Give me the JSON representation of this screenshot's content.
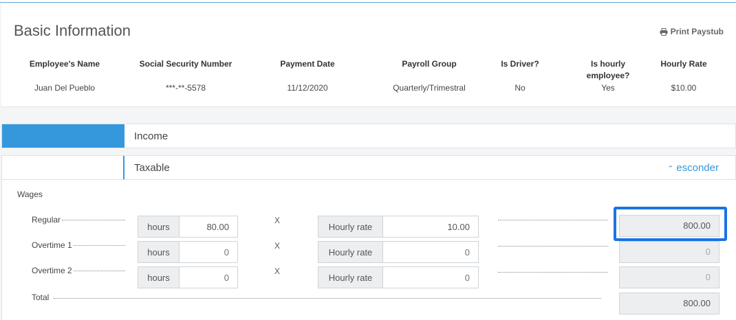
{
  "basic_info": {
    "title": "Basic Information",
    "print_label": "Print Paystub",
    "columns": [
      {
        "header": "Employee's Name",
        "value": "Juan Del Pueblo"
      },
      {
        "header": "Social Security Number",
        "value": "***-**-5578"
      },
      {
        "header": "Payment Date",
        "value": "11/12/2020"
      },
      {
        "header": "Payroll Group",
        "value": "Quarterly/Trimestral"
      },
      {
        "header": "Is Driver?",
        "value": "No"
      },
      {
        "header": "Is hourly employee?",
        "value": "Yes"
      },
      {
        "header": "Hourly Rate",
        "value": "$10.00"
      }
    ]
  },
  "sections": {
    "income_label": "Income",
    "taxable_label": "Taxable",
    "hide_label": "esconder"
  },
  "wages": {
    "title": "Wages",
    "multiply_symbol": "X",
    "rows": [
      {
        "label": "Regular",
        "hours_addon": "hours",
        "hours": "80.00",
        "rate_addon": "Hourly rate",
        "rate": "10.00",
        "result": "800.00"
      },
      {
        "label": "Overtime 1",
        "hours_addon": "hours",
        "hours": "0",
        "rate_addon": "Hourly rate",
        "rate": "0",
        "result": "0"
      },
      {
        "label": "Overtime 2",
        "hours_addon": "hours",
        "hours": "0",
        "rate_addon": "Hourly rate",
        "rate": "0",
        "result": "0"
      }
    ],
    "total_label": "Total",
    "total_value": "800.00"
  },
  "icons": {
    "print": "printer-icon",
    "hide": "chevron-up-icon"
  },
  "colors": {
    "accent": "#3598dc",
    "highlight": "#1a73e8"
  }
}
